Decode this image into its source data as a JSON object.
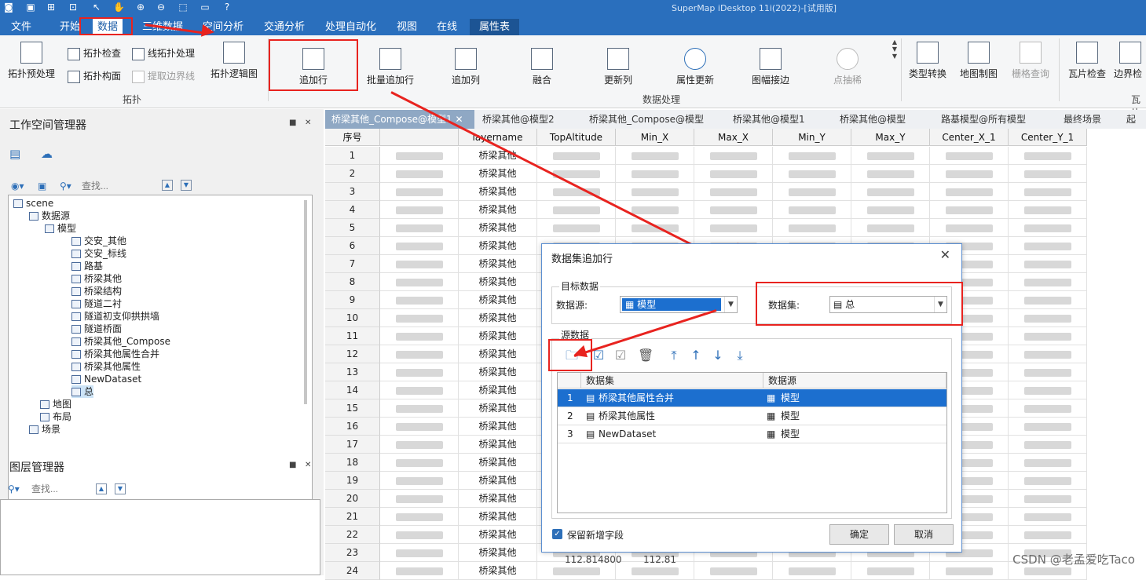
{
  "app": {
    "title": "SuperMap iDesktop 11i(2022)-[试用版]"
  },
  "menu": {
    "tabs": [
      "文件",
      "开始",
      "数据",
      "三维数据",
      "空间分析",
      "交通分析",
      "处理自动化",
      "视图",
      "在线",
      "属性表"
    ]
  },
  "ribbon": {
    "topology": {
      "pre_process": "拓扑预处理",
      "check": "拓扑检查",
      "build_polygon": "拓扑构面",
      "line_process": "线拓扑处理",
      "extract_boundary": "提取边界线",
      "logic_graph": "拓扑逻辑图",
      "group": "拓扑"
    },
    "data_processing": {
      "add_row": "追加行",
      "batch_add_row": "批量追加行",
      "add_column": "追加列",
      "merge": "融合",
      "update_column": "更新列",
      "attr_update": "属性更新",
      "edge_match": "图幅接边",
      "point_thin": "点抽稀",
      "group": "数据处理"
    },
    "more": {
      "type_convert": "类型转换",
      "map_cartography": "地图制图",
      "raster_query": "栅格查询",
      "tile_check": "瓦片检查",
      "boundary_check": "边界检",
      "group_tile": "瓦片"
    }
  },
  "workspace": {
    "title": "工作空间管理器",
    "search_placeholder": "查找...",
    "tree": {
      "scene": "scene",
      "datasources": "数据源",
      "model": "模型",
      "items": [
        "交安_其他",
        "交安_标线",
        "路基",
        "桥梁其他",
        "桥梁结构",
        "隧道二衬",
        "隧道初支仰拱拱墙",
        "隧道桥面",
        "桥梁其他_Compose",
        "桥梁其他属性合并",
        "桥梁其他属性",
        "NewDataset",
        "总"
      ],
      "map": "地图",
      "layout": "布局",
      "scene_node": "场景"
    }
  },
  "layers": {
    "title": "图层管理器",
    "search_placeholder": "查找..."
  },
  "table": {
    "tabs": [
      "桥梁其他_Compose@模型1",
      "桥梁其他@模型2",
      "桥梁其他_Compose@模型",
      "桥梁其他@模型1",
      "桥梁其他@模型",
      "路基模型@所有模型",
      "最终场景",
      "起"
    ],
    "columns": [
      "序号",
      "",
      "layername",
      "TopAltitude",
      "Min_X",
      "Max_X",
      "Min_Y",
      "Max_Y",
      "Center_X_1",
      "Center_Y_1"
    ],
    "row_numbers": [
      "1",
      "2",
      "3",
      "4",
      "5",
      "6",
      "7",
      "8",
      "9",
      "10",
      "11",
      "12",
      "13",
      "14",
      "15",
      "16",
      "17",
      "18",
      "19",
      "20",
      "21",
      "22",
      "23",
      "24"
    ],
    "layername_value": "桥梁其他",
    "partial_values": [
      "112.814800",
      "112.81"
    ]
  },
  "dialog": {
    "title": "数据集追加行",
    "target_group": "目标数据",
    "datasource_label": "数据源:",
    "datasource_value": "模型",
    "dataset_label": "数据集:",
    "dataset_value": "总",
    "source_group": "源数据",
    "columns": [
      "数据集",
      "数据源"
    ],
    "rows": [
      {
        "n": "1",
        "dataset": "桥梁其他属性合并",
        "source": "模型"
      },
      {
        "n": "2",
        "dataset": "桥梁其他属性",
        "source": "模型"
      },
      {
        "n": "3",
        "dataset": "NewDataset",
        "source": "模型"
      }
    ],
    "keep_fields": "保留新增字段",
    "ok": "确定",
    "cancel": "取消"
  },
  "watermark": "CSDN @老孟爱吃Taco",
  "colors": {
    "accent": "#2a6fbd",
    "highlight": "#e8231f",
    "selection": "#1c6fcf"
  }
}
